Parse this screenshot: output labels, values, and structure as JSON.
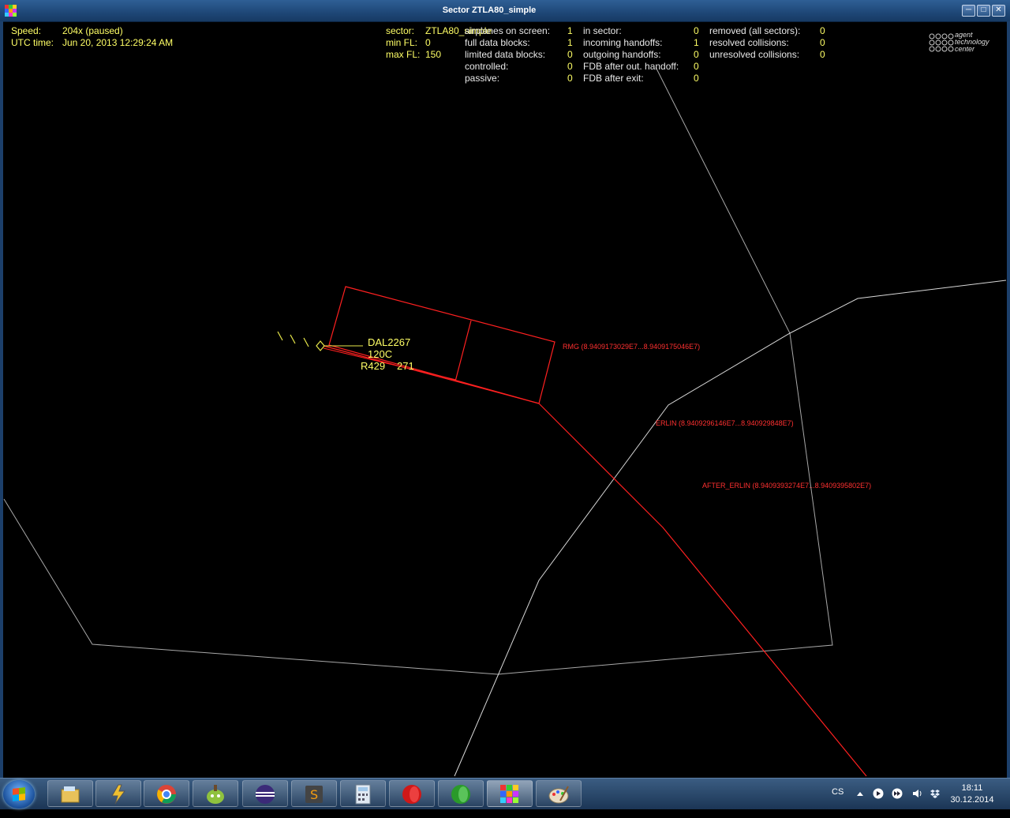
{
  "window": {
    "title": "Sector ZTLA80_simple"
  },
  "status": {
    "speed_label": "Speed:",
    "speed_value": "204x (paused)",
    "utc_label": "UTC time:",
    "utc_value": "Jun 20, 2013 12:29:24 AM"
  },
  "sector_info": {
    "sector_label": "sector:",
    "sector_value": "ZTLA80_simple",
    "min_fl_label": "min FL:",
    "min_fl_value": "0",
    "max_fl_label": "max FL:",
    "max_fl_value": "150"
  },
  "stats_col1": [
    {
      "label": "airplanes on screen:",
      "value": "1"
    },
    {
      "label": "full data blocks:",
      "value": "1"
    },
    {
      "label": "limited data blocks:",
      "value": "0"
    },
    {
      "label": "controlled:",
      "value": "0"
    },
    {
      "label": "passive:",
      "value": "0"
    }
  ],
  "stats_col2": [
    {
      "label": "in sector:",
      "value": "0"
    },
    {
      "label": "incoming handoffs:",
      "value": "1"
    },
    {
      "label": "outgoing handoffs:",
      "value": "0"
    },
    {
      "label": "FDB after out. handoff:",
      "value": "0"
    },
    {
      "label": "FDB after exit:",
      "value": "0"
    }
  ],
  "stats_col3": [
    {
      "label": "removed (all sectors):",
      "value": "0"
    },
    {
      "label": "resolved collisions:",
      "value": "0"
    },
    {
      "label": "unresolved collisions:",
      "value": "0"
    }
  ],
  "logo": {
    "line1": "agent",
    "line2": "technology",
    "line3": "center"
  },
  "aircraft": {
    "callsign": "DAL2267",
    "altitude": "120C",
    "route": "R429",
    "speed": "271"
  },
  "waypoints": {
    "rmg": "RMG (8.9409173029E7...8.9409175046E7)",
    "erlin": "ERLIN (8.9409296146E7...8.940929848E7)",
    "after_erlin": "AFTER_ERLIN (8.9409393274E7...8.9409395802E7)"
  },
  "colors": {
    "route": "#ff2020",
    "sector_lines": "#aaaaaa",
    "data_text": "#ffff66"
  },
  "taskbar": {
    "apps": [
      "explorer-icon",
      "winamp-icon",
      "chrome-icon",
      "android-sdk-icon",
      "eclipse-icon",
      "sublime-icon",
      "calculator-icon",
      "record-icon",
      "green-app-icon",
      "atc-app-icon",
      "paint-icon"
    ],
    "language": "CS",
    "time": "18:11",
    "date": "30.12.2014"
  }
}
